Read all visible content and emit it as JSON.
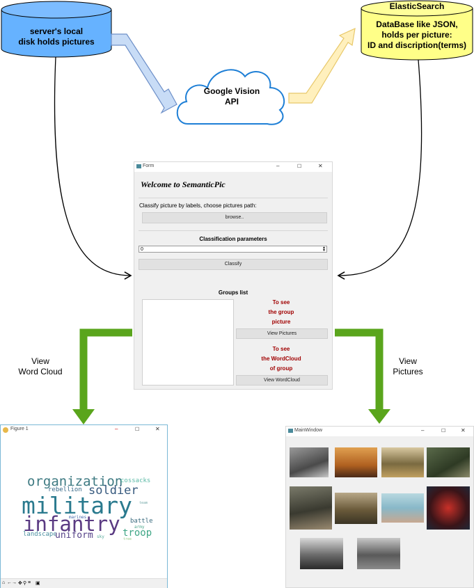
{
  "diagram": {
    "disk_label_1": "server's local",
    "disk_label_2": "disk holds pictures",
    "cloud_label_1": "Google Vision",
    "cloud_label_2": "API",
    "db_title": "ElasticSearch",
    "db_line_1": "DataBase like JSON,",
    "db_line_2": "holds per picture:",
    "db_line_3": "ID and discription(terms)",
    "left_arrow_line_1": "View",
    "left_arrow_line_2": "Word Cloud",
    "right_arrow_line_1": "View",
    "right_arrow_line_2": "Pictures",
    "colors": {
      "disk": "#66b2ff",
      "db": "#ffff88",
      "green": "#5aa51c",
      "cloud_border": "#1e7fd6"
    }
  },
  "form": {
    "title": "Form",
    "heading": "Welcome to SemanticPic",
    "instruction": "Classify picture by labels, choose pictures path:",
    "browse_label": "browse..",
    "params_heading": "Classification parameters",
    "spin_value": "0",
    "classify_label": "Classify",
    "groups_heading": "Groups list",
    "see_group_1": "To see",
    "see_group_2": "the group",
    "see_group_3": "picture",
    "view_pictures_label": "View Pictures",
    "see_wc_1": "To see",
    "see_wc_2": "the WordCloud",
    "see_wc_3": "of group",
    "view_wordcloud_label": "View WordCloud"
  },
  "figure": {
    "title": "Figure 1",
    "words": {
      "organization": "organization",
      "cossacks": "cossacks",
      "rebellion": "rebellion",
      "soldier": "soldier",
      "military": "military",
      "infantry": "infantry",
      "battle": "battle",
      "army": "army",
      "landscape": "landscape",
      "uniform": "uniform",
      "troop": "troop",
      "marines": "marines",
      "sky": "sky",
      "tree": "tree",
      "team": "team"
    },
    "toolbar_icons": [
      "home-icon",
      "back-icon",
      "forward-icon",
      "pan-icon",
      "zoom-icon",
      "configure-icon",
      "save-icon"
    ]
  },
  "mainwindow": {
    "title": "MainWindow"
  }
}
